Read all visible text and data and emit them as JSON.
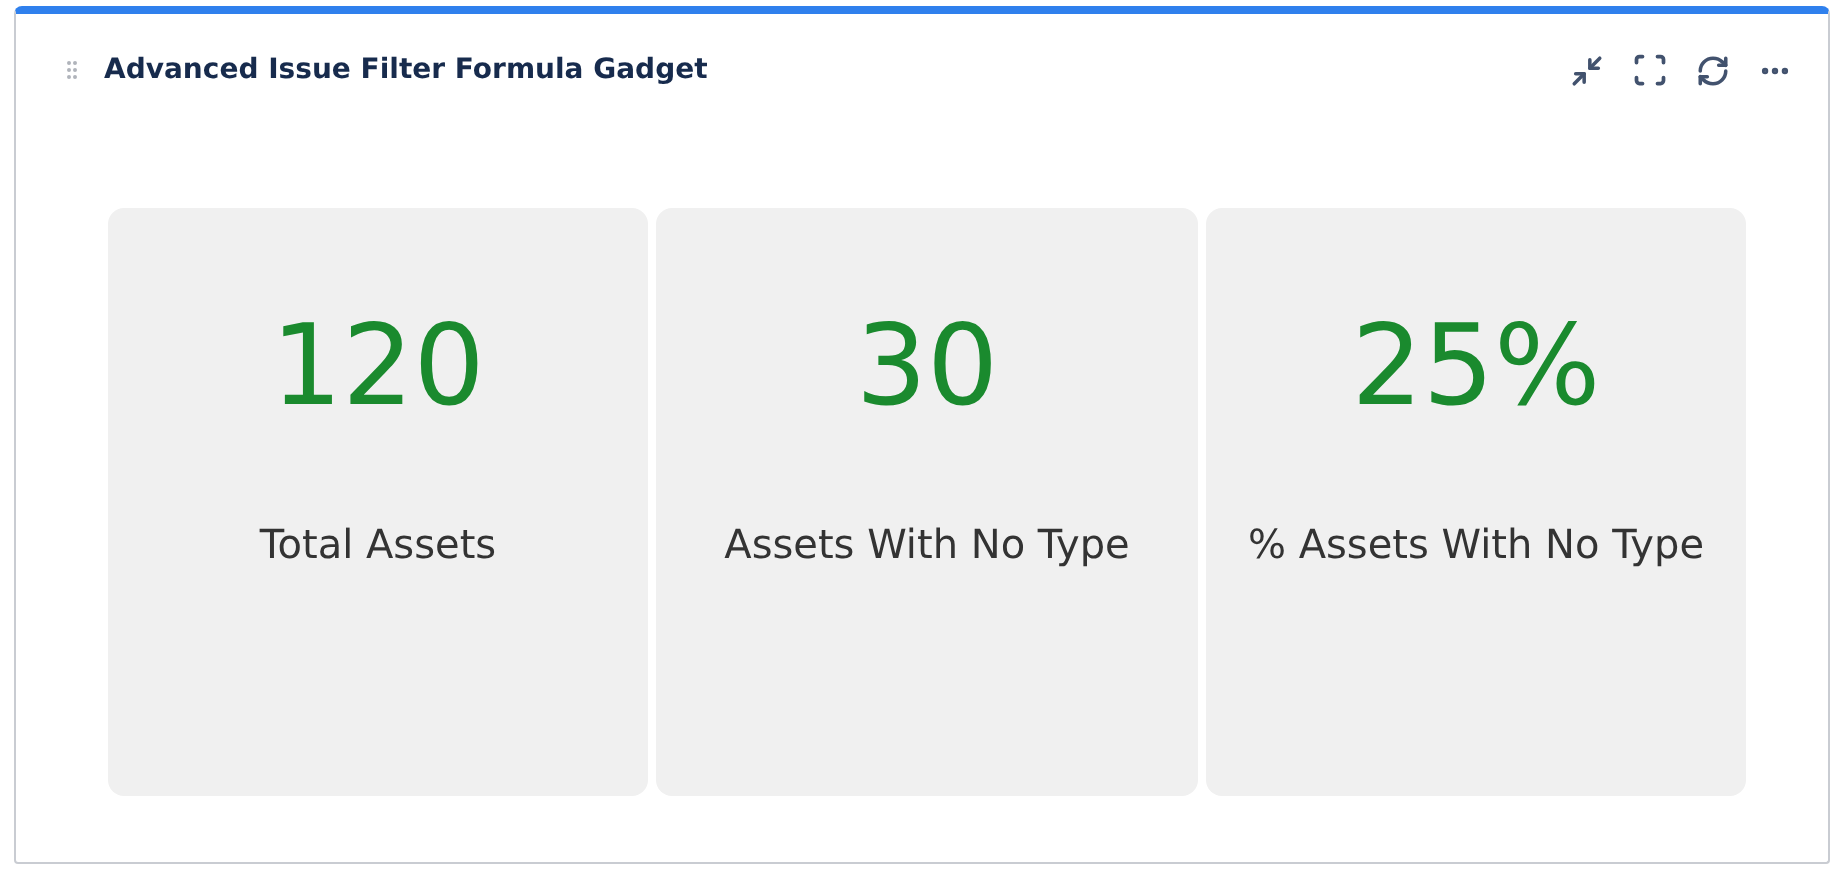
{
  "gadget": {
    "title": "Advanced Issue Filter Formula Gadget"
  },
  "metrics": [
    {
      "value": "120",
      "label": "Total Assets"
    },
    {
      "value": "30",
      "label": "Assets With No Type"
    },
    {
      "value": "25%",
      "label": "% Assets With No Type"
    }
  ]
}
